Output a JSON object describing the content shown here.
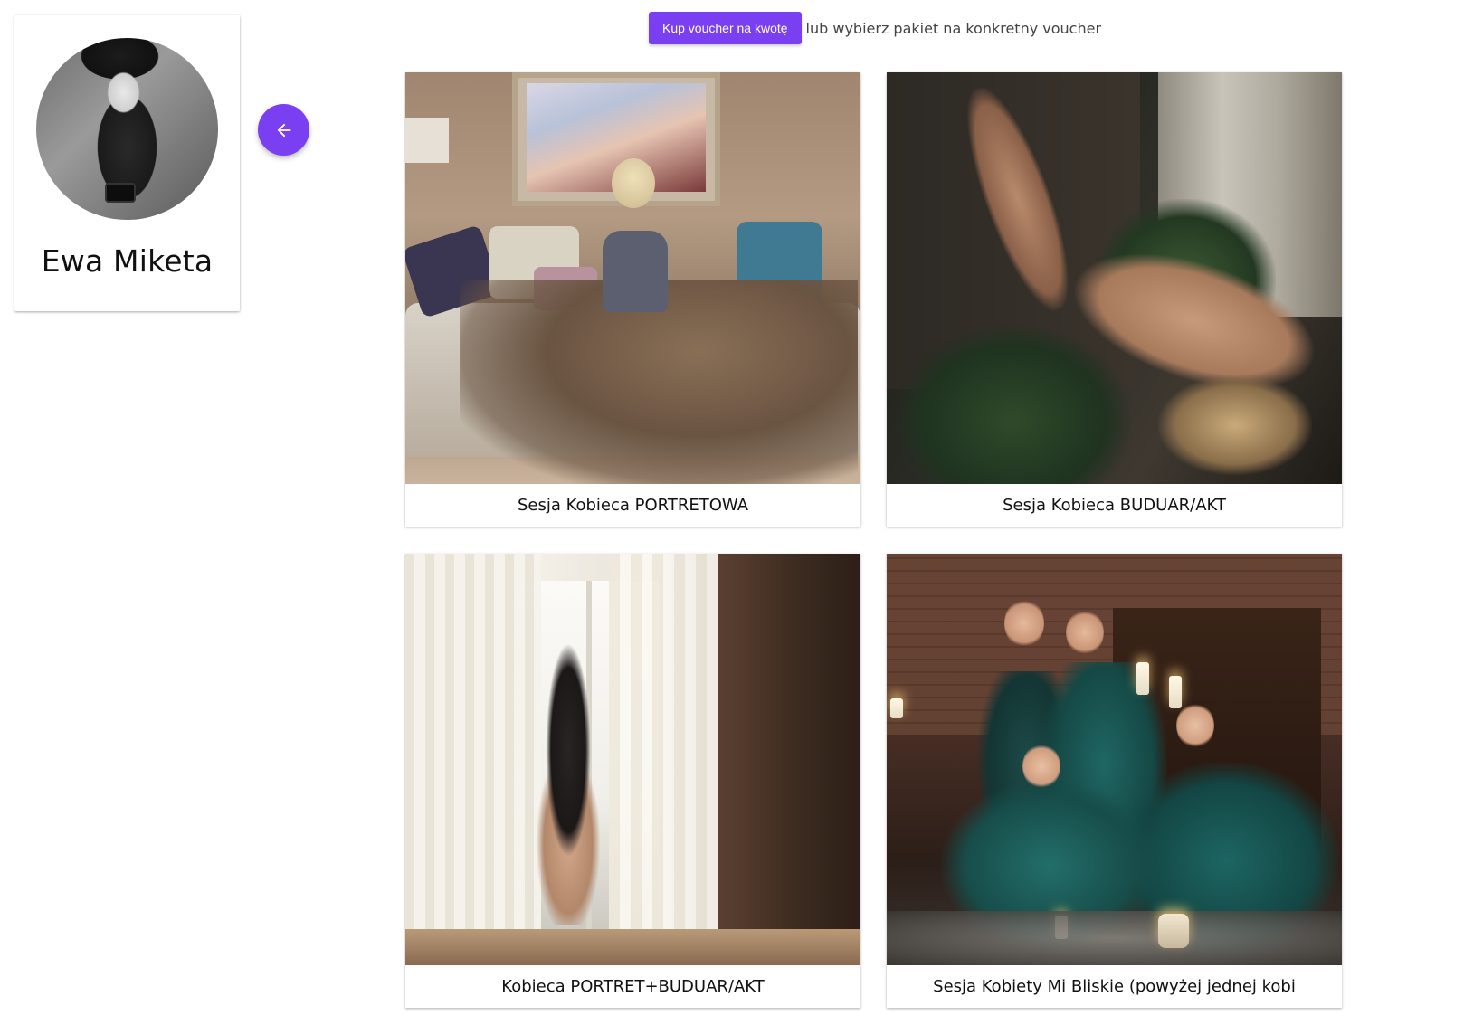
{
  "profile": {
    "name": "Ewa Miketa"
  },
  "topbar": {
    "voucher_button_label": "Kup voucher na kwotę",
    "helper_text": "lub wybierz pakiet na konkretny voucher"
  },
  "packages": [
    {
      "title": "Sesja Kobieca PORTRETOWA"
    },
    {
      "title": "Sesja Kobieca BUDUAR/AKT"
    },
    {
      "title": "Kobieca PORTRET+BUDUAR/AKT"
    },
    {
      "title": "Sesja Kobiety Mi Bliskie (powyżej jednej kobi"
    }
  ],
  "colors": {
    "accent": "#7b3ff2"
  },
  "icons": {
    "back": "arrow-left-icon"
  }
}
